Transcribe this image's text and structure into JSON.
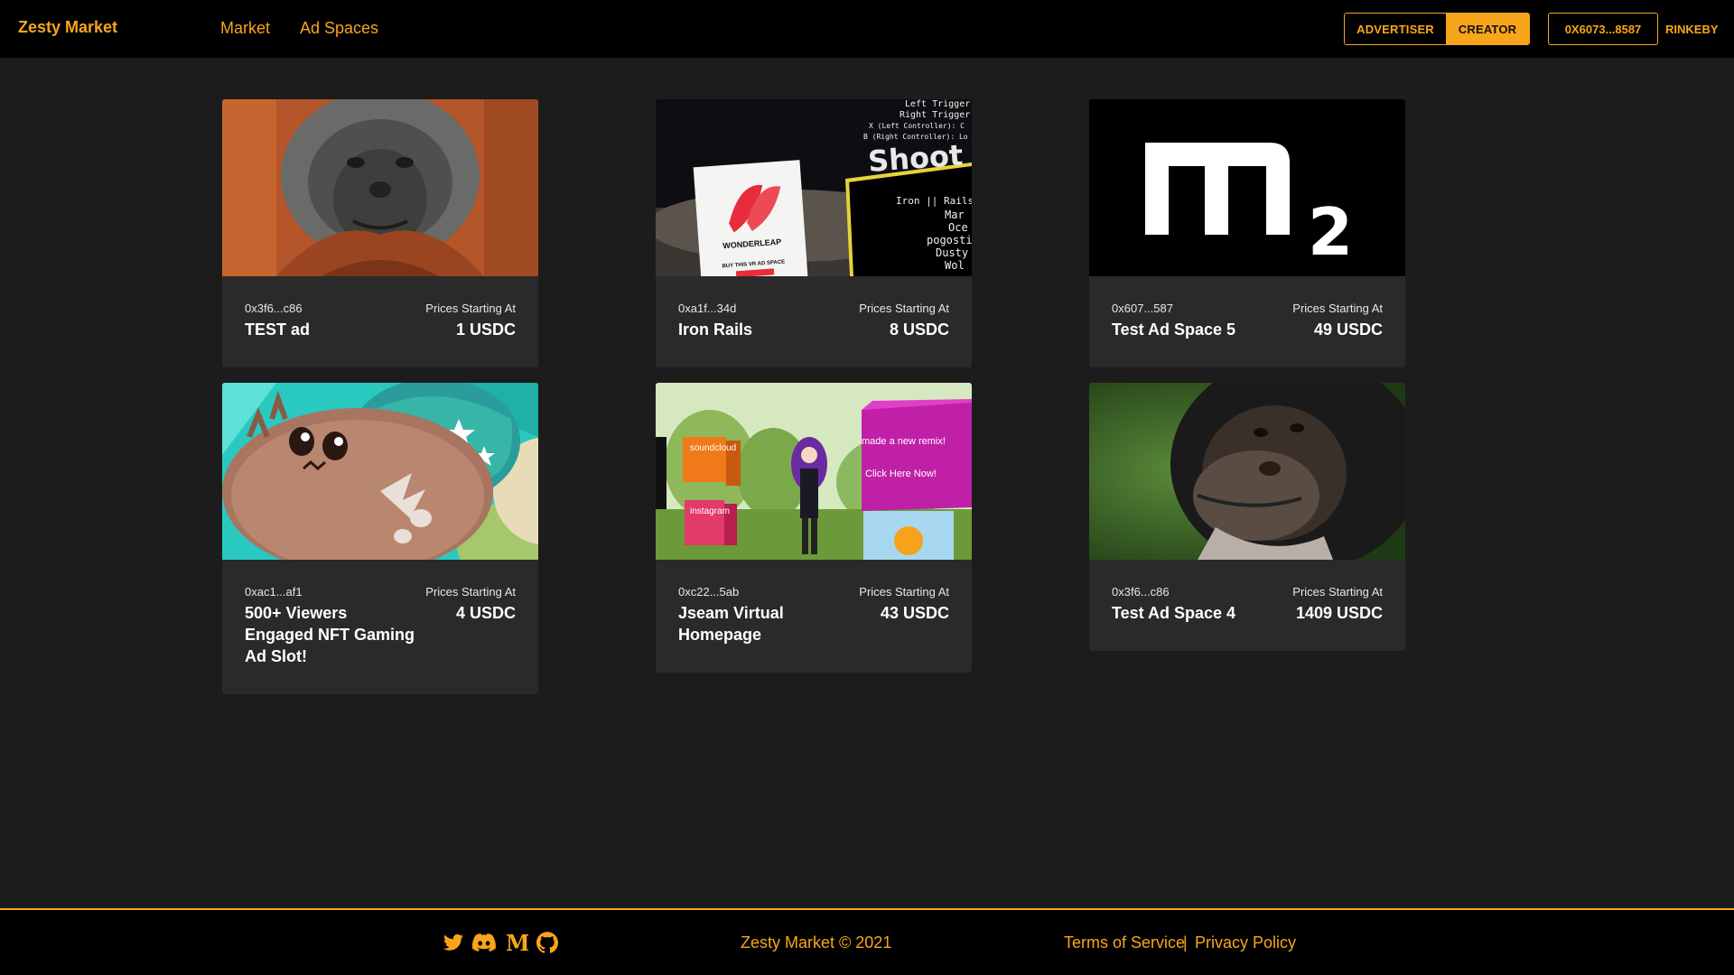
{
  "header": {
    "brand": "Zesty Market",
    "nav": [
      "Market",
      "Ad Spaces"
    ],
    "roles": {
      "advertiser": "ADVERTISER",
      "creator": "CREATOR",
      "active": "CREATOR"
    },
    "wallet": "0X6073...8587",
    "network": "RINKEBY"
  },
  "colors": {
    "accent": "#f8a51b",
    "background": "#1c1c1c",
    "card": "#2a2a2a",
    "bar": "#000000"
  },
  "price_label": "Prices Starting At",
  "cards": [
    {
      "address": "0x3f6...c86",
      "title": "TEST ad",
      "price": "1 USDC",
      "image": "orangutan-photo"
    },
    {
      "address": "0xa1f...34d",
      "title": "Iron Rails",
      "price": "8 USDC",
      "image": "vr-scene-shoot"
    },
    {
      "address": "0x607...587",
      "title": "Test Ad Space 5",
      "price": "49 USDC",
      "image": "m2-logo"
    },
    {
      "address": "0xac1...af1",
      "title": "500+ Viewers Engaged NFT Gaming Ad Slot!",
      "price": "4 USDC",
      "image": "axie-creature"
    },
    {
      "address": "0xc22...5ab",
      "title": "Jseam Virtual Homepage",
      "price": "43 USDC",
      "image": "virtual-homepage-scene"
    },
    {
      "address": "0x3f6...c86",
      "title": "Test Ad Space 4",
      "price": "1409 USDC",
      "image": "chimpanzee-photo"
    }
  ],
  "card_images": {
    "vr_sign": "WONDERLEAP",
    "vr_sign_sub": "BUY THIS VR AD SPACE",
    "vr_board_title": "Shoot",
    "vr_board_top": [
      "Left Trigger:",
      "Right Trigger:",
      "X (Left Controller): C",
      "B (Right Controller): Lo"
    ],
    "vr_board_list": [
      "Iron || Rails M",
      "Mar",
      "Oce",
      "pogosti",
      "Dusty",
      "Wol"
    ],
    "m2_text": "m",
    "m2_sub": "2",
    "home_soundcloud": "soundcloud",
    "home_instagram": "instagram",
    "home_remix": "made a new remix!",
    "home_click": "Click Here Now!"
  },
  "footer": {
    "social": [
      "twitter-icon",
      "discord-icon",
      "medium-icon",
      "github-icon"
    ],
    "medium_glyph": "M",
    "copyright": "Zesty Market © 2021",
    "terms": "Terms of Service",
    "separator": "|",
    "privacy": "Privacy Policy"
  }
}
